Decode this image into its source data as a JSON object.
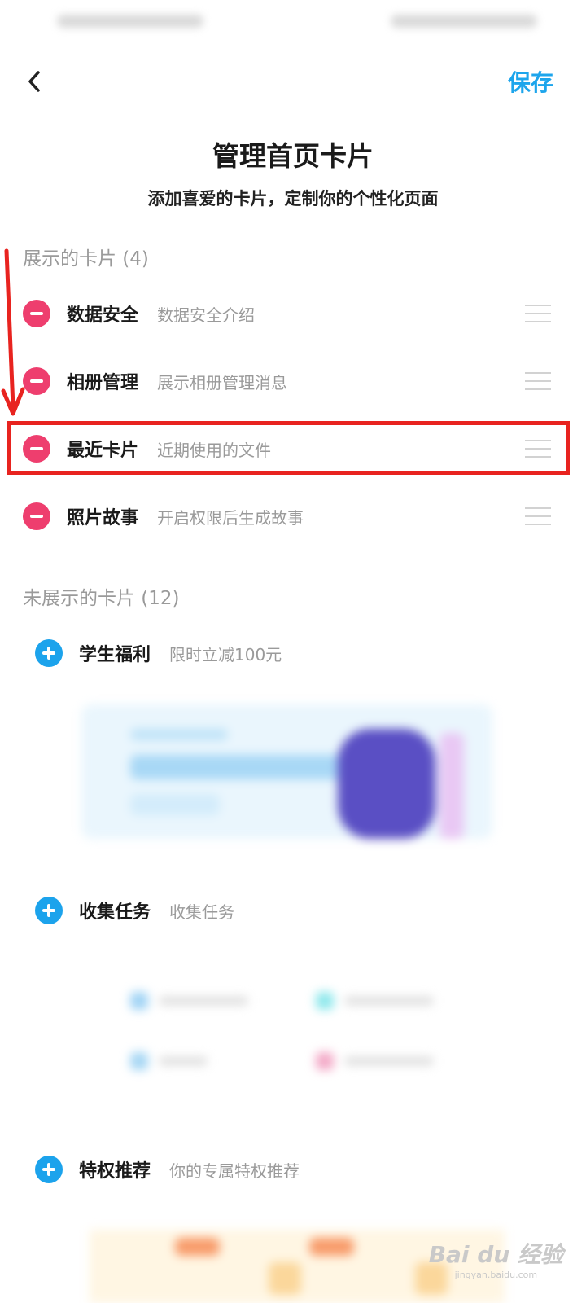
{
  "header": {
    "save_label": "保存"
  },
  "page": {
    "title": "管理首页卡片",
    "subtitle": "添加喜爱的卡片，定制你的个性化页面"
  },
  "shown_section": {
    "title": "展示的卡片 (4)",
    "items": [
      {
        "name": "数据安全",
        "desc": "数据安全介绍"
      },
      {
        "name": "相册管理",
        "desc": "展示相册管理消息"
      },
      {
        "name": "最近卡片",
        "desc": "近期使用的文件"
      },
      {
        "name": "照片故事",
        "desc": "开启权限后生成故事"
      }
    ]
  },
  "hidden_section": {
    "title": "未展示的卡片 (12)",
    "items": [
      {
        "name": "学生福利",
        "desc": "限时立减100元"
      },
      {
        "name": "收集任务",
        "desc": "收集任务"
      },
      {
        "name": "特权推荐",
        "desc": "你的专属特权推荐"
      }
    ]
  },
  "annotation": {
    "highlight_color": "#e8231f"
  },
  "colors": {
    "accent_blue": "#1da5ec",
    "remove_red": "#ee3e6e"
  },
  "icons": [
    "back-arrow-icon",
    "minus-circle-icon",
    "plus-circle-icon",
    "drag-handle-icon"
  ],
  "watermark": {
    "main": "Bai du 经验",
    "sub": "jingyan.baidu.com"
  }
}
